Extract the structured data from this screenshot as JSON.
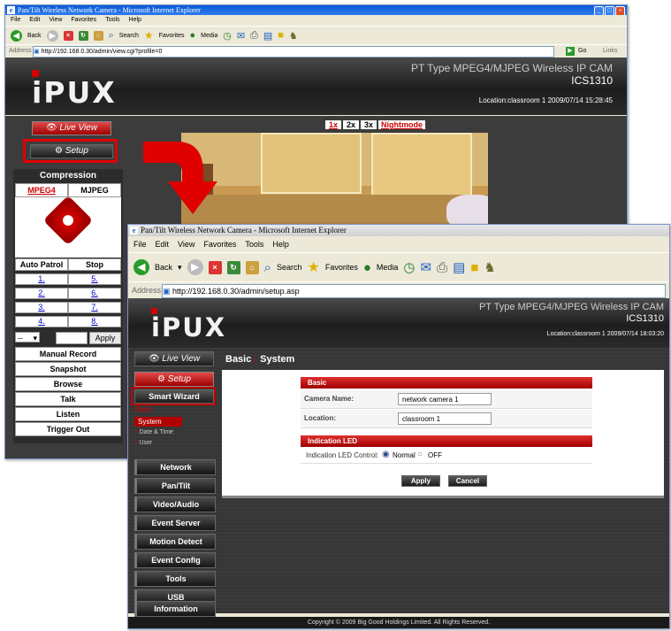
{
  "back_window": {
    "title": "Pan/Tilt Wireless Network Camera - Microsoft Internet Explorer",
    "menu": [
      "File",
      "Edit",
      "View",
      "Favorites",
      "Tools",
      "Help"
    ],
    "toolbar": {
      "back": "Back",
      "search": "Search",
      "favorites": "Favorites",
      "media": "Media"
    },
    "address_label": "Address",
    "address": "http://192.168.0.30/admin/view.cgi?profile=0",
    "go": "Go",
    "links": "Links",
    "header": {
      "product": "PT Type MPEG4/MJPEG Wireless IP CAM",
      "model": "ICS1310",
      "location": "Location:classroom 1   2009/07/14 15:28:45"
    },
    "logo": "iPUX",
    "live_view": "Live View",
    "setup": "Setup",
    "zoom_buttons": [
      "1x",
      "2x",
      "3x"
    ],
    "nightmode": "Nightmode",
    "compression_label": "Compression",
    "mpeg4": "MPEG4",
    "mjpeg": "MJPEG",
    "auto_patrol": "Auto Patrol",
    "stop": "Stop",
    "presets": [
      "1.",
      "5.",
      "2.",
      "6.",
      "3.",
      "7.",
      "4.",
      "8."
    ],
    "preset_select": "--",
    "apply": "Apply",
    "actions": [
      "Manual Record",
      "Snapshot",
      "Browse",
      "Talk",
      "Listen",
      "Trigger Out"
    ]
  },
  "front_window": {
    "title": "Pan/Tilt Wireless Network Camera - Microsoft Internet Explorer",
    "menu": [
      "File",
      "Edit",
      "View",
      "Favorites",
      "Tools",
      "Help"
    ],
    "toolbar": {
      "back": "Back",
      "search": "Search",
      "favorites": "Favorites",
      "media": "Media"
    },
    "address_label": "Address",
    "address": "http://192.168.0.30/admin/setup.asp",
    "header": {
      "product": "PT Type MPEG4/MJPEG Wireless IP CAM",
      "model": "ICS1310",
      "location": "Location:classroom 1   2009/07/14 18:03:20"
    },
    "logo": "iPUX",
    "live_view": "Live View",
    "setup": "Setup",
    "smart_wizard": "Smart Wizard",
    "basic_label": "Basic",
    "submenu": [
      "System",
      "Date & Time",
      "User"
    ],
    "side_buttons": [
      "Network",
      "Pan/Tilt",
      "Video/Audio",
      "Event Server",
      "Motion Detect",
      "Event Config",
      "Tools",
      "USB",
      "Information"
    ],
    "page_title_a": "Basic",
    "page_title_b": "System",
    "section_basic": "Basic",
    "camera_name_label": "Camera Name:",
    "camera_name_value": "network camera 1",
    "location_label": "Location:",
    "location_value": "classroom 1",
    "section_led": "Indication LED",
    "led_label": "Indication LED Control:",
    "led_normal": "Normal",
    "led_off": "OFF",
    "apply": "Apply",
    "cancel": "Cancel",
    "copyright": "Copyright © 2009 Big Good Holdings Limited. All Rights Reserved."
  },
  "colors": {
    "accent_red": "#d40000",
    "callout_red": "#e00000",
    "dark_bg": "#3a3a3a"
  }
}
